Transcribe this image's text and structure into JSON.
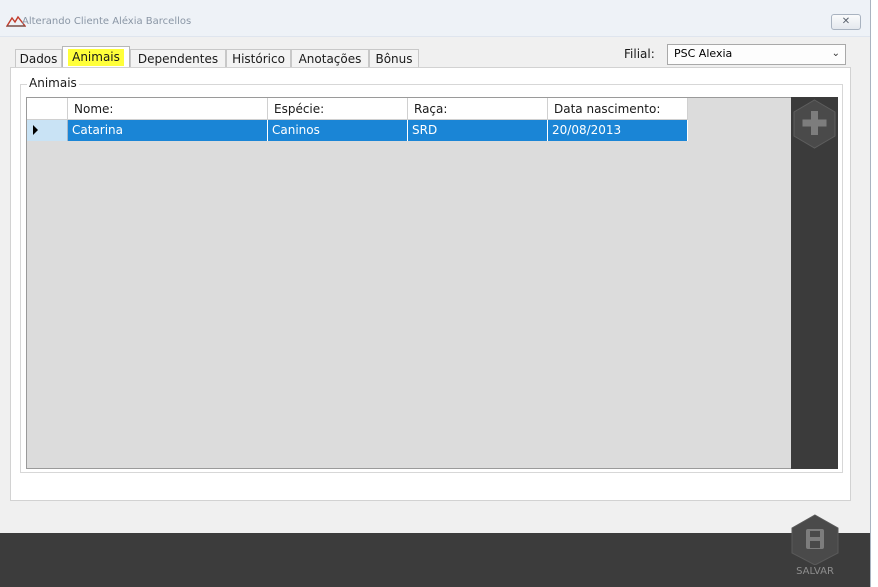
{
  "window": {
    "title": "Alterando Cliente Aléxia Barcellos",
    "close_glyph": "✕"
  },
  "tabs": [
    {
      "label": "Dados",
      "active": false
    },
    {
      "label": "Animais",
      "active": true
    },
    {
      "label": "Dependentes",
      "active": false
    },
    {
      "label": "Histórico",
      "active": false
    },
    {
      "label": "Anotações",
      "active": false
    },
    {
      "label": "Bônus",
      "active": false
    }
  ],
  "filial": {
    "label": "Filial:",
    "value": "PSC Alexia"
  },
  "animais": {
    "group_title": "Animais",
    "columns": [
      "Nome:",
      "Espécie:",
      "Raça:",
      "Data nascimento:"
    ],
    "rows": [
      {
        "nome": "Catarina",
        "especie": "Caninos",
        "raca": "SRD",
        "data_nascimento": "20/08/2013",
        "selected": true
      }
    ],
    "add_icon": "plus-icon"
  },
  "footer": {
    "save_label": "SALVAR",
    "save_icon": "floppy-disk-icon"
  },
  "colors": {
    "selection": "#1a85d6",
    "highlight": "#ffff3a",
    "dark_bar": "#3c3c3c"
  }
}
